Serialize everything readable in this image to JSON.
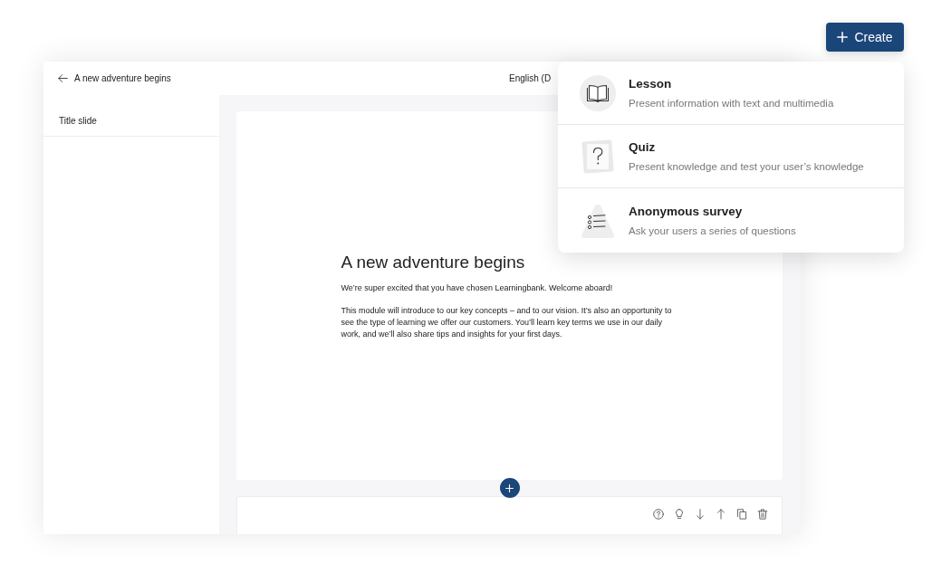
{
  "create_button": {
    "label": "Create"
  },
  "editor": {
    "header": {
      "title": "A new adventure begins",
      "language": "English (D"
    },
    "sidebar": {
      "items": [
        {
          "label": "Title slide"
        }
      ]
    },
    "slide": {
      "title": "A new adventure begins",
      "paragraphs": [
        "We’re super excited that you have chosen Learningbank. Welcome aboard!",
        "This module will introduce to our key concepts – and to our vision. It’s also an opportunity to see the type of learning we offer our customers. You’ll learn key terms we use in our daily work, and we’ll also share tips and insights for your first days."
      ]
    }
  },
  "create_menu": {
    "items": [
      {
        "kind": "lesson",
        "title": "Lesson",
        "description": "Present information with text and multimedia"
      },
      {
        "kind": "quiz",
        "title": "Quiz",
        "description": "Present knowledge and test your user’s knowledge"
      },
      {
        "kind": "survey",
        "title": "Anonymous survey",
        "description": "Ask your users a series of questions"
      }
    ]
  }
}
